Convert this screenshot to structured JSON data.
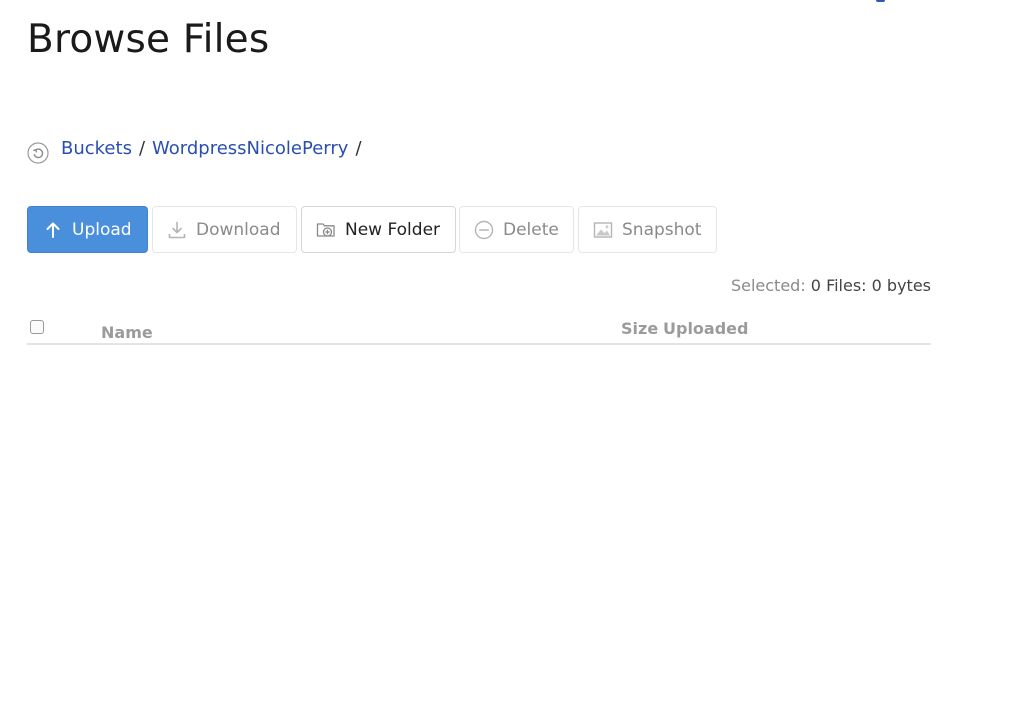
{
  "page": {
    "title": "Browse Files"
  },
  "breadcrumb": {
    "back_icon": "circular-arrow-back-icon",
    "items": [
      {
        "label": "Buckets"
      },
      {
        "label": "WordpressNicolePerry"
      }
    ],
    "separator": "/"
  },
  "toolbar": {
    "upload": {
      "label": "Upload",
      "icon": "arrow-up-icon"
    },
    "download": {
      "label": "Download",
      "icon": "download-icon"
    },
    "new_folder": {
      "label": "New Folder",
      "icon": "folder-plus-icon"
    },
    "delete": {
      "label": "Delete",
      "icon": "minus-circle-icon"
    },
    "snapshot": {
      "label": "Snapshot",
      "icon": "image-icon"
    }
  },
  "selection": {
    "label": "Selected:",
    "value": "0 Files: 0 bytes"
  },
  "table": {
    "columns": {
      "name": "Name",
      "size": "Size",
      "uploaded": "Uploaded"
    }
  },
  "colors": {
    "primary": "#4a8fdb",
    "link": "#2a4fb0"
  }
}
